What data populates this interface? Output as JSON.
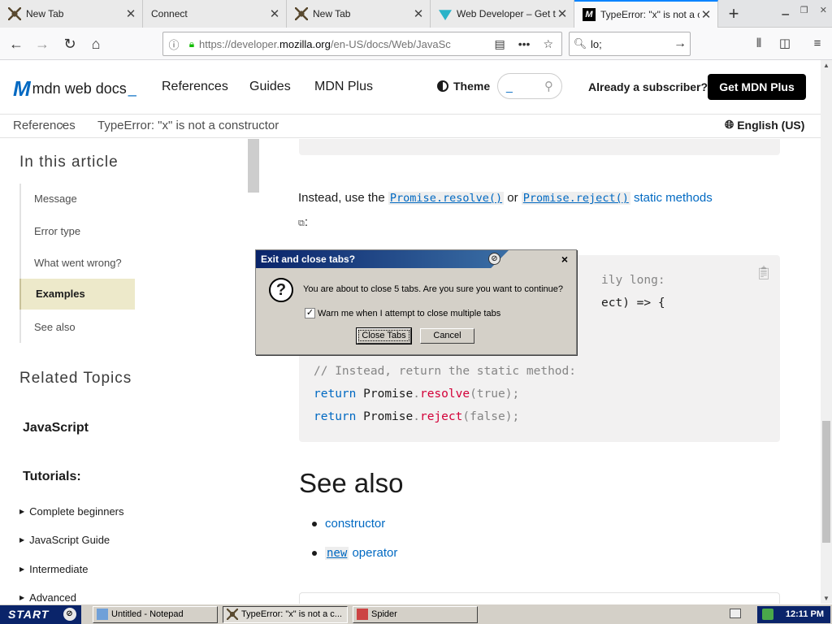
{
  "browser": {
    "tabs": [
      {
        "title": "New Tab",
        "icon": "spider-icon"
      },
      {
        "title": "Connect",
        "icon": ""
      },
      {
        "title": "New Tab",
        "icon": "spider-icon"
      },
      {
        "title": "Web Developer – Get th",
        "icon": "webdev-icon"
      },
      {
        "title": "TypeError: \"x\" is not a c",
        "icon": "mdn-icon"
      }
    ],
    "active_tab_index": 4,
    "url_host_prefix": "https://developer.",
    "url_host": "mozilla.org",
    "url_path": "/en-US/docs/Web/JavaSc",
    "search_value": "lo;",
    "accent": "#0a84ff"
  },
  "mdn": {
    "logo_text": "mdn web docs",
    "nav": [
      "References",
      "Guides",
      "MDN Plus"
    ],
    "theme_label": "Theme",
    "search_placeholder": "_",
    "subscriber_text": "Already a subscriber?",
    "get_plus_label": "Get MDN Plus",
    "breadcrumb": [
      "References",
      "TypeError: \"x\" is not a constructor"
    ],
    "language": "English (US)",
    "brand_color": "#0069c2"
  },
  "sidebar": {
    "toc_heading": "In this article",
    "toc_items": [
      "Message",
      "Error type",
      "What went wrong?",
      "Examples",
      "See also"
    ],
    "toc_active": "Examples",
    "related_heading": "Related Topics",
    "javascript_heading": "JavaScript",
    "tutorials_heading": "Tutorials:",
    "tutorial_items": [
      "Complete beginners",
      "JavaScript Guide",
      "Intermediate",
      "Advanced"
    ]
  },
  "content": {
    "para_prefix": "Instead, use the",
    "code_resolve": "Promise.resolve()",
    "or_text": "or",
    "code_reject": "Promise.reject()",
    "static_methods_link": "static methods",
    "after_link": ":",
    "code_lines": [
      {
        "kind": "comment",
        "text": "ily long:"
      },
      {
        "kind": "plain",
        "text": "ect) => {"
      },
      {
        "kind": "comment",
        "text": "// Instead, return the static method:"
      }
    ],
    "code_return_1": {
      "kw": "return",
      "obj": "Promise",
      "dot": ".",
      "fn": "resolve",
      "args": "(true);"
    },
    "code_return_2": {
      "kw": "return",
      "obj": "Promise",
      "dot": ".",
      "fn": "reject",
      "args": "(false);"
    },
    "see_also_heading": "See also",
    "see_also_items": [
      {
        "link": "constructor"
      },
      {
        "code": "new",
        "link": "operator"
      }
    ]
  },
  "dialog": {
    "title": "Exit and close tabs?",
    "message": "You are about to close 5 tabs. Are you sure you want to continue?",
    "checkbox_label": "Warn me when I attempt to close multiple tabs",
    "checkbox_checked": true,
    "primary_button": "Close Tabs",
    "secondary_button": "Cancel"
  },
  "taskbar": {
    "start_label": "START",
    "tasks": [
      {
        "title": "Untitled - Notepad",
        "icon": "notepad-icon",
        "pressed": false
      },
      {
        "title": "TypeError: \"x\" is not a c...",
        "icon": "spider-icon",
        "pressed": true
      },
      {
        "title": "Spider",
        "icon": "spider-icon",
        "pressed": false
      }
    ],
    "clock": "12:11 PM"
  }
}
